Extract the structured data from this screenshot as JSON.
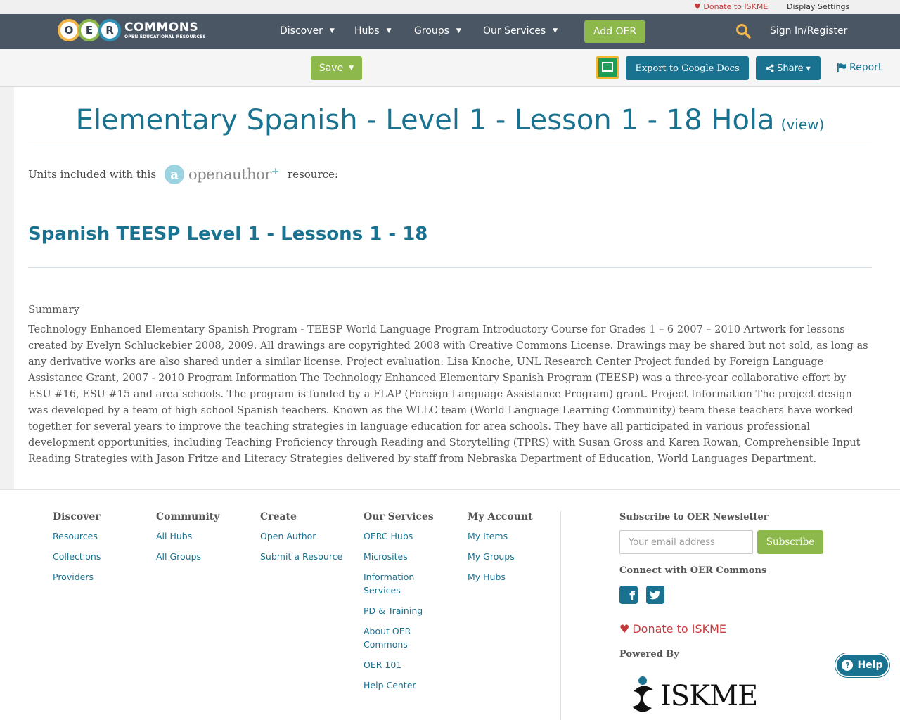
{
  "utility": {
    "donate": "Donate to ISKME",
    "display_settings": "Display Settings"
  },
  "nav": {
    "logo_letters": [
      "O",
      "E",
      "R"
    ],
    "logo_word": "COMMONS",
    "logo_sub": "OPEN EDUCATIONAL RESOURCES",
    "items": [
      {
        "label": "Discover"
      },
      {
        "label": "Hubs"
      },
      {
        "label": "Groups"
      },
      {
        "label": "Our Services"
      }
    ],
    "add_oer": "Add OER",
    "sign_in": "Sign In/Register"
  },
  "toolbar": {
    "save": "Save",
    "export": "Export to Google Docs",
    "share": "Share",
    "report": "Report"
  },
  "resource": {
    "title": "Elementary Spanish - Level 1 - Lesson 1 - 18 Hola",
    "view_link": "(view)",
    "units_prefix": "Units included with this",
    "openauthor_a": "a",
    "openauthor_text": "openauthor",
    "openauthor_plus": "+",
    "units_suffix": "resource:",
    "unit_title": "Spanish TEESP Level 1 - Lessons 1 - 18",
    "summary_heading": "Summary",
    "summary_text": "Technology Enhanced Elementary Spanish Program - TEESP World Language Program Introductory Course for Grades 1 – 6 2007 – 2010 Artwork for lessons created by Evelyn Schluckebier 2008, 2009. All drawings are copyrighted 2008 with Creative Commons License. Drawings may be shared but not sold, as long as any derivative works are also shared under a similar license. Project evaluation: Lisa Knoche, UNL Research Center Project funded by Foreign Language Assistance Grant, 2007 - 2010 Program Information The Technology Enhanced Elementary Spanish Program (TEESP) was a three-year collaborative effort by ESU #16, ESU #15 and area schools. The program is funded by a FLAP (Foreign Language Assistance Program) grant. Project Information The project design was developed by a team of high school Spanish teachers. Known as the WLLC team (World Language Learning Community) team these teachers have worked together for several years to improve the teaching strategies in language education for area schools. They have all participated in various professional development opportunities, including Teaching Proficiency through Reading and Storytelling (TPRS) with Susan Gross and Karen Rowan, Comprehensible Input Reading Strategies with Jason Fritze and Literacy Strategies delivered by staff from Nebraska Department of Education, World Languages Department."
  },
  "footer": {
    "columns": [
      {
        "heading": "Discover",
        "links": [
          "Resources",
          "Collections",
          "Providers"
        ]
      },
      {
        "heading": "Community",
        "links": [
          "All Hubs",
          "All Groups"
        ]
      },
      {
        "heading": "Create",
        "links": [
          "Open Author",
          "Submit a Resource"
        ]
      },
      {
        "heading": "Our Services",
        "links": [
          "OERC Hubs",
          "Microsites",
          "Information Services",
          "PD & Training",
          "About OER Commons",
          "OER 101",
          "Help Center"
        ]
      },
      {
        "heading": "My Account",
        "links": [
          "My Items",
          "My Groups",
          "My Hubs"
        ]
      }
    ],
    "newsletter_heading": "Subscribe to OER Newsletter",
    "email_placeholder": "Your email address",
    "subscribe": "Subscribe",
    "connect_heading": "Connect with OER Commons",
    "donate": "Donate to ISKME",
    "powered_by": "Powered By",
    "iskme": "ISKME"
  },
  "help_button": "Help",
  "colors": {
    "nav_bg": "#4a5664",
    "accent_green": "#8db84b",
    "accent_blue": "#1a7291",
    "donate_red": "#c7393a"
  }
}
